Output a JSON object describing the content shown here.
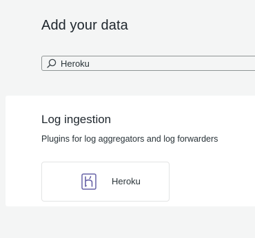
{
  "page": {
    "title": "Add your data"
  },
  "search": {
    "value": "Heroku",
    "icon": "search-icon"
  },
  "section": {
    "title": "Log ingestion",
    "description": "Plugins for log aggregators and log forwarders"
  },
  "tiles": [
    {
      "label": "Heroku",
      "icon": "heroku-logo-icon",
      "color": "#6762a6"
    }
  ]
}
